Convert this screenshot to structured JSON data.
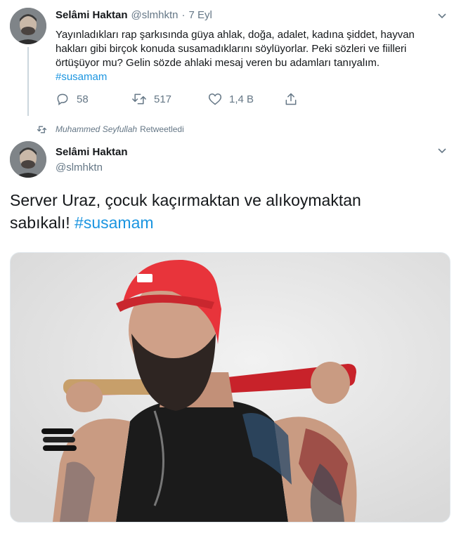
{
  "tweet1": {
    "name": "Selâmi Haktan",
    "handle": "@slmhktn",
    "separator": "·",
    "date": "7 Eyl",
    "text": "Yayınladıkları rap şarkısında güya ahlak, doğa, adalet, kadına şiddet, hayvan hakları gibi birçok konuda susamadıklarını söylüyorlar. Peki sözleri ve fiilleri örtüşüyor mu? Gelin sözde ahlaki mesaj veren bu adamları tanıyalım.",
    "hashtag": "#susamam",
    "replies": "58",
    "retweets": "517",
    "likes": "1,4 B"
  },
  "retweet_banner": {
    "user": "Muhammed Seyfullah",
    "label": "Retweetledi"
  },
  "tweet2": {
    "name": "Selâmi Haktan",
    "handle": "@slmhktn",
    "text": "Server Uraz, çocuk kaçırmaktan ve alıkoymaktan sabıkalı!",
    "hashtag": "#susamam"
  },
  "icons": {
    "reply": "reply-icon",
    "retweet": "retweet-icon",
    "like": "heart-icon",
    "share": "share-icon",
    "more": "chevron-down-icon"
  },
  "colors": {
    "link": "#1b95e0",
    "muted": "#657786",
    "text": "#14171a",
    "cap": "#e8343b"
  }
}
